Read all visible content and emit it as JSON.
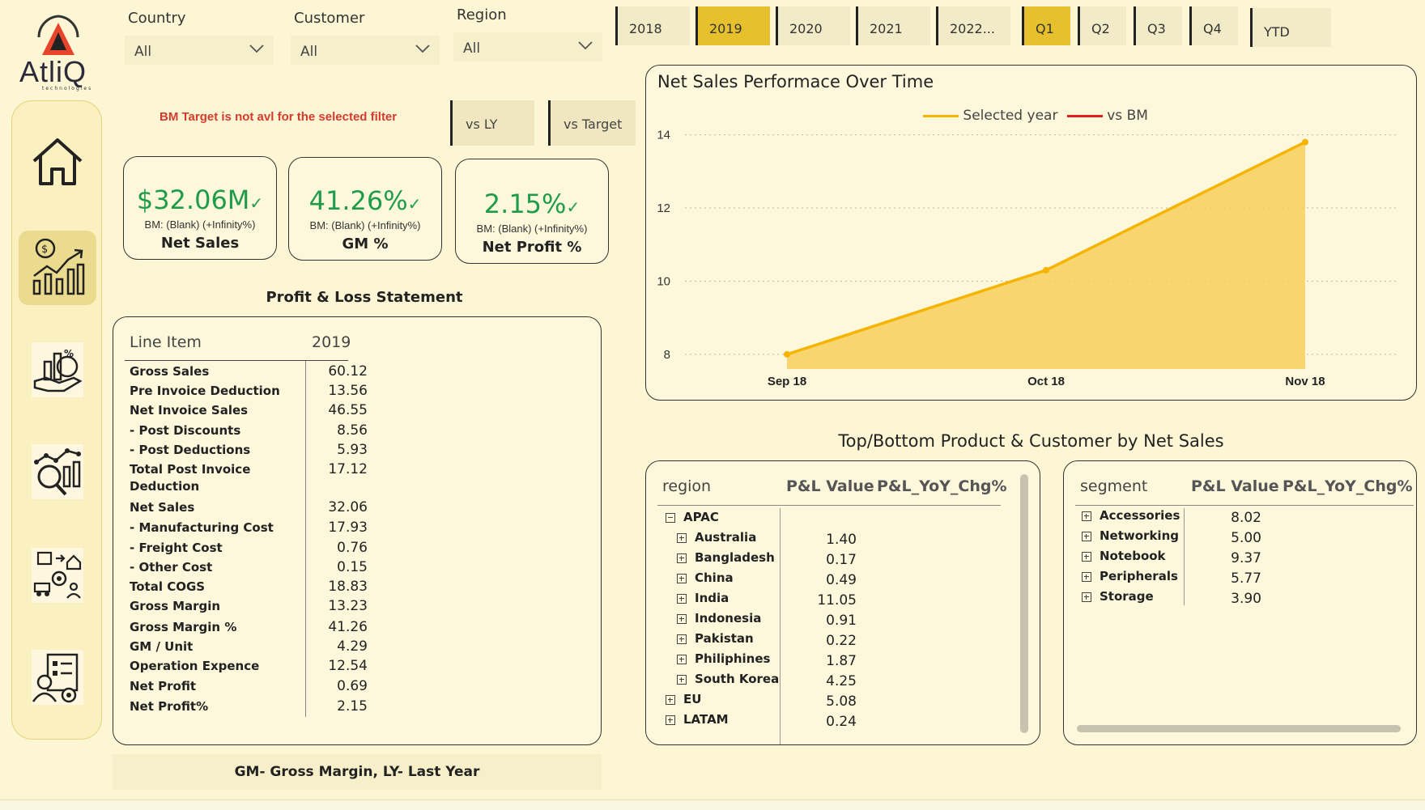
{
  "brand": {
    "name": "AtliQ",
    "sub": "technologies"
  },
  "filters": [
    {
      "label": "Country",
      "value": "All"
    },
    {
      "label": "Customer",
      "value": "All"
    },
    {
      "label": "Region",
      "value": "All"
    }
  ],
  "years": [
    "2018",
    "2019",
    "2020",
    "2021",
    "2022..."
  ],
  "selected_year": "2019",
  "quarters": [
    "Q1",
    "Q2",
    "Q3",
    "Q4"
  ],
  "selected_quarter": "Q1",
  "ytd_label": "YTD",
  "bm_warning": "BM Target is not avl for the selected filter",
  "toggles": [
    "vs LY",
    "vs Target"
  ],
  "kpis": [
    {
      "value": "$32.06M",
      "check": "✓",
      "bm": "BM: (Blank) (+Infinity%)",
      "name": "Net Sales"
    },
    {
      "value": "41.26%",
      "check": "✓",
      "bm": "BM: (Blank) (+Infinity%)",
      "name": "GM %"
    },
    {
      "value": "2.15%",
      "check": "✓",
      "bm": "BM: (Blank) (+Infinity%)",
      "name": "Net Profit %"
    }
  ],
  "pl": {
    "title": "Profit & Loss Statement",
    "col_item": "Line Item",
    "col_year": "2019",
    "rows": [
      {
        "label": "Gross Sales",
        "value": "60.12"
      },
      {
        "label": "Pre Invoice Deduction",
        "value": "13.56"
      },
      {
        "label": "Net Invoice Sales",
        "value": "46.55"
      },
      {
        "label": "- Post Discounts",
        "value": "8.56"
      },
      {
        "label": "- Post Deductions",
        "value": "5.93"
      },
      {
        "label": "Total Post Invoice Deduction",
        "value": "17.12"
      },
      {
        "label": "Net Sales",
        "value": "32.06"
      },
      {
        "label": "- Manufacturing Cost",
        "value": "17.93"
      },
      {
        "label": "- Freight Cost",
        "value": "0.76"
      },
      {
        "label": "- Other Cost",
        "value": "0.15"
      },
      {
        "label": "Total COGS",
        "value": "18.83"
      },
      {
        "label": "Gross Margin",
        "value": "13.23"
      },
      {
        "label": "Gross Margin %",
        "value": "41.26"
      },
      {
        "label": "GM / Unit",
        "value": "4.29"
      },
      {
        "label": "Operation Expence",
        "value": "12.54"
      },
      {
        "label": "Net Profit",
        "value": "0.69"
      },
      {
        "label": "Net Profit%",
        "value": "2.15"
      }
    ]
  },
  "footnote": "GM- Gross Margin, LY- Last Year",
  "chart_data": {
    "type": "area",
    "title": "Net Sales Performace Over Time",
    "categories": [
      "Sep 18",
      "Oct 18",
      "Nov 18"
    ],
    "series": [
      {
        "name": "Selected year",
        "color": "#f5b400",
        "values": [
          8.0,
          10.3,
          13.8
        ]
      },
      {
        "name": "vs BM",
        "color": "#e02020",
        "values": []
      }
    ],
    "yticks": [
      "8",
      "10",
      "12",
      "14"
    ],
    "ylim": [
      7.6,
      14.3
    ],
    "legend": "top-center",
    "grid": true
  },
  "topbottom": {
    "title": "Top/Bottom Product & Customer by Net Sales",
    "region_table": {
      "headers": [
        "region",
        "P&L Value",
        "P&L_YoY_Chg%"
      ],
      "rows": [
        {
          "label": "APAC",
          "value": "",
          "level": 0,
          "expanded": true
        },
        {
          "label": "Australia",
          "value": "1.40",
          "level": 1
        },
        {
          "label": "Bangladesh",
          "value": "0.17",
          "level": 1
        },
        {
          "label": "China",
          "value": "0.49",
          "level": 1
        },
        {
          "label": "India",
          "value": "11.05",
          "level": 1
        },
        {
          "label": "Indonesia",
          "value": "0.91",
          "level": 1
        },
        {
          "label": "Pakistan",
          "value": "0.22",
          "level": 1
        },
        {
          "label": "Philiphines",
          "value": "1.87",
          "level": 1
        },
        {
          "label": "South Korea",
          "value": "4.25",
          "level": 1
        },
        {
          "label": "EU",
          "value": "5.08",
          "level": 0
        },
        {
          "label": "LATAM",
          "value": "0.24",
          "level": 0
        }
      ]
    },
    "segment_table": {
      "headers": [
        "segment",
        "P&L Value",
        "P&L_YoY_Chg%"
      ],
      "rows": [
        {
          "label": "Accessories",
          "value": "8.02"
        },
        {
          "label": "Networking",
          "value": "5.00"
        },
        {
          "label": "Notebook",
          "value": "9.37"
        },
        {
          "label": "Peripherals",
          "value": "5.77"
        },
        {
          "label": "Storage",
          "value": "3.90"
        }
      ]
    }
  }
}
